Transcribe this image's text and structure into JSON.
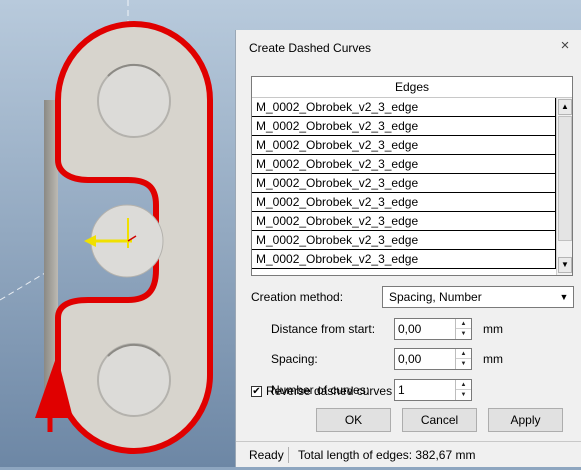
{
  "dialog": {
    "title": "Create Dashed Curves",
    "close_glyph": "×",
    "edges_header": "Edges",
    "edges": [
      "M_0002_Obrobek_v2_3_edge",
      "M_0002_Obrobek_v2_3_edge",
      "M_0002_Obrobek_v2_3_edge",
      "M_0002_Obrobek_v2_3_edge",
      "M_0002_Obrobek_v2_3_edge",
      "M_0002_Obrobek_v2_3_edge",
      "M_0002_Obrobek_v2_3_edge",
      "M_0002_Obrobek_v2_3_edge",
      "M_0002_Obrobek_v2_3_edge"
    ],
    "creation_method_label": "Creation method:",
    "creation_method_value": "Spacing, Number",
    "distance_label": "Distance from start:",
    "distance_value": "0,00",
    "distance_unit": "mm",
    "spacing_label": "Spacing:",
    "spacing_value": "0,00",
    "spacing_unit": "mm",
    "number_label": "Number of curves:",
    "number_value": "1",
    "reverse_label": "Reverse dashed curves",
    "reverse_checked": true,
    "ok_label": "OK",
    "cancel_label": "Cancel",
    "apply_label": "Apply",
    "status_ready": "Ready",
    "status_total": "Total length of edges: 382,67 mm"
  },
  "colors": {
    "viewport_bg_top": "#b7c9dc",
    "viewport_bg_bottom": "#6c86a4",
    "part_fill": "#d6d3cc",
    "edge_highlight": "#e00000",
    "axis_yellow": "#f0e000"
  },
  "icons": {
    "check": "✔",
    "up": "▲",
    "down": "▼"
  }
}
